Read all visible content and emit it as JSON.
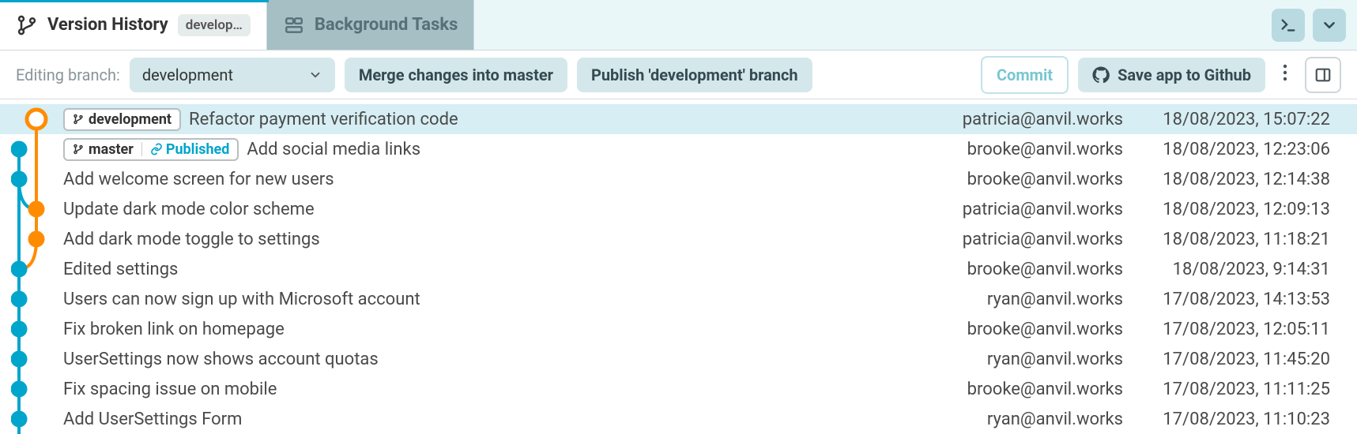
{
  "tabs": {
    "active": {
      "title": "Version History",
      "badge": "develop…"
    },
    "inactive": {
      "title": "Background Tasks"
    }
  },
  "toolbar": {
    "editing_label": "Editing branch:",
    "branch_select": "development",
    "merge_btn": "Merge changes into master",
    "publish_btn": "Publish 'development' branch",
    "commit_btn": "Commit",
    "save_btn": "Save app to Github"
  },
  "commits": [
    {
      "branch": "development",
      "published": false,
      "msg": "Refactor payment verification code",
      "author": "patricia@anvil.works",
      "ts": "18/08/2023, 15:07:22",
      "selected": true,
      "node": {
        "x": 32,
        "color": "orange",
        "open": true
      }
    },
    {
      "branch": "master",
      "published": true,
      "msg": "Add social media links",
      "author": "brooke@anvil.works",
      "ts": "18/08/2023, 12:23:06",
      "selected": false,
      "node": {
        "x": 10,
        "color": "blue",
        "open": false
      }
    },
    {
      "branch": null,
      "published": false,
      "msg": "Add welcome screen for new users",
      "author": "brooke@anvil.works",
      "ts": "18/08/2023, 12:14:38",
      "selected": false,
      "node": {
        "x": 10,
        "color": "blue",
        "open": false
      }
    },
    {
      "branch": null,
      "published": false,
      "msg": "Update dark mode color scheme",
      "author": "patricia@anvil.works",
      "ts": "18/08/2023, 12:09:13",
      "selected": false,
      "node": {
        "x": 32,
        "color": "orange",
        "open": false
      }
    },
    {
      "branch": null,
      "published": false,
      "msg": "Add dark mode toggle to settings",
      "author": "patricia@anvil.works",
      "ts": "18/08/2023, 11:18:21",
      "selected": false,
      "node": {
        "x": 32,
        "color": "orange",
        "open": false
      }
    },
    {
      "branch": null,
      "published": false,
      "msg": "Edited settings",
      "author": "brooke@anvil.works",
      "ts": "18/08/2023, 9:14:31",
      "selected": false,
      "node": {
        "x": 10,
        "color": "blue",
        "open": false
      }
    },
    {
      "branch": null,
      "published": false,
      "msg": "Users can now sign up with Microsoft account",
      "author": "ryan@anvil.works",
      "ts": "17/08/2023, 14:13:53",
      "selected": false,
      "node": {
        "x": 10,
        "color": "blue",
        "open": false
      }
    },
    {
      "branch": null,
      "published": false,
      "msg": "Fix broken link on homepage",
      "author": "brooke@anvil.works",
      "ts": "17/08/2023, 12:05:11",
      "selected": false,
      "node": {
        "x": 10,
        "color": "blue",
        "open": false
      }
    },
    {
      "branch": null,
      "published": false,
      "msg": "UserSettings now shows account quotas",
      "author": "ryan@anvil.works",
      "ts": "17/08/2023, 11:45:20",
      "selected": false,
      "node": {
        "x": 10,
        "color": "blue",
        "open": false
      }
    },
    {
      "branch": null,
      "published": false,
      "msg": "Fix spacing issue on mobile",
      "author": "brooke@anvil.works",
      "ts": "17/08/2023, 11:11:25",
      "selected": false,
      "node": {
        "x": 10,
        "color": "blue",
        "open": false
      }
    },
    {
      "branch": null,
      "published": false,
      "msg": "Add UserSettings Form",
      "author": "ryan@anvil.works",
      "ts": "17/08/2023, 11:10:23",
      "selected": false,
      "node": {
        "x": 10,
        "color": "blue",
        "open": false
      }
    }
  ],
  "colors": {
    "blue": "#00a5cc",
    "orange": "#ff8c00"
  }
}
